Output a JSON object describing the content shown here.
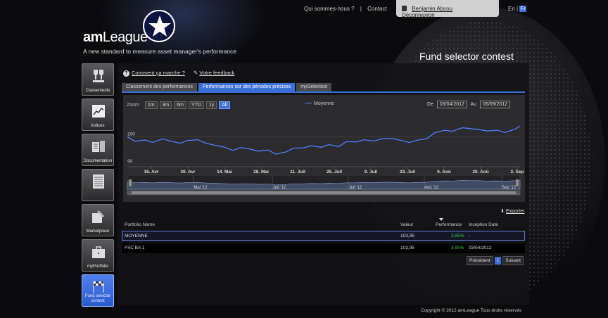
{
  "topnav": {
    "about": "Qui sommes-nous ?",
    "separator": "|",
    "contact": "Contact",
    "user_name": "Benjamin Abcou",
    "logout": "Déconnexion",
    "lang_en": "En",
    "lang_sep": "|",
    "lang_fr": "Fr"
  },
  "brand": {
    "logo_bold": "am",
    "logo_light": "League",
    "tagline": "A new standard to measure asset manager's performance",
    "section_title": "Fund selector contest"
  },
  "sidebar": {
    "items": [
      {
        "label": "Classements",
        "icon": "trophy-icon"
      },
      {
        "label": "Indices",
        "icon": "chart-icon"
      },
      {
        "label": "Documentation",
        "icon": "documents-icon"
      },
      {
        "label": "",
        "icon": "newspaper-icon"
      },
      {
        "label": "Marketplace",
        "icon": "marketplace-icon"
      },
      {
        "label": "myPortfolio",
        "icon": "briefcase-icon"
      },
      {
        "label": "Fund selector contest",
        "icon": "flags-icon"
      }
    ]
  },
  "help": {
    "how": "Comment ça marche ?",
    "feedback": "Votre feedback"
  },
  "tabs": [
    {
      "label": "Classement des performances"
    },
    {
      "label": "Performances sur des périodes précises"
    },
    {
      "label": "mySelection"
    }
  ],
  "chart_controls": {
    "zoom_label": "Zoom",
    "zoom_options": [
      "1m",
      "3m",
      "6m",
      "YTD",
      "1y",
      "All"
    ],
    "zoom_selected": "All",
    "legend": "Moyenne",
    "from_label": "De",
    "from_date": "03/04/2012",
    "to_label": "Au",
    "to_date": "06/09/2012"
  },
  "chart_data": {
    "type": "line",
    "series": [
      {
        "name": "Moyenne",
        "color": "#4f7fff",
        "x": [
          "2012-04-03",
          "2012-04-06",
          "2012-04-10",
          "2012-04-13",
          "2012-04-17",
          "2012-04-20",
          "2012-04-24",
          "2012-04-27",
          "2012-05-01",
          "2012-05-04",
          "2012-05-08",
          "2012-05-11",
          "2012-05-15",
          "2012-05-18",
          "2012-05-22",
          "2012-05-25",
          "2012-05-29",
          "2012-06-01",
          "2012-06-05",
          "2012-06-08",
          "2012-06-12",
          "2012-06-15",
          "2012-06-19",
          "2012-06-22",
          "2012-06-26",
          "2012-06-29",
          "2012-07-03",
          "2012-07-06",
          "2012-07-10",
          "2012-07-13",
          "2012-07-17",
          "2012-07-20",
          "2012-07-24",
          "2012-07-27",
          "2012-07-31",
          "2012-08-03",
          "2012-08-07",
          "2012-08-10",
          "2012-08-14",
          "2012-08-17",
          "2012-08-21",
          "2012-08-24",
          "2012-08-28",
          "2012-08-31",
          "2012-09-04",
          "2012-09-06"
        ],
        "values": [
          100.0,
          98.3,
          98.8,
          97.9,
          99.2,
          98.4,
          97.6,
          98.6,
          98.9,
          97.7,
          96.8,
          96.3,
          95.0,
          96.0,
          95.4,
          94.7,
          95.1,
          93.6,
          94.4,
          95.8,
          95.9,
          96.7,
          96.1,
          97.1,
          96.4,
          98.2,
          98.1,
          98.9,
          98.4,
          99.2,
          99.4,
          98.8,
          97.9,
          98.7,
          99.3,
          101.4,
          102.4,
          102.0,
          103.3,
          103.0,
          102.6,
          102.1,
          102.4,
          101.5,
          102.8,
          103.95
        ]
      }
    ],
    "xlabel": "",
    "ylabel": "",
    "ylim": [
      90,
      105
    ],
    "yticks": [
      "100",
      "90"
    ],
    "xtick_labels": [
      "16. Avr",
      "30. Avr",
      "14. Mai",
      "28. Mai",
      "11. Juil",
      "25. Juil",
      "9. Juil",
      "23. Juil",
      "6. Aoû",
      "20. Aoû",
      "3. Sep"
    ],
    "navigator_labels": [
      "Mai '12",
      "Juil '12",
      "Juil '12",
      "Aoû '12",
      "Sep '12"
    ]
  },
  "export": "Exporter",
  "table": {
    "headers": [
      "Portfolio Name",
      "Valeur",
      "Performance",
      "Inception Date"
    ],
    "rows": [
      [
        "MOYENNE",
        "103,95",
        "3,95%",
        "-"
      ],
      [
        "FSC BA 1",
        "103,95",
        "3,95%",
        "03/04/2012"
      ]
    ]
  },
  "pager": {
    "prev": "Précédent",
    "page": "1",
    "next": "Suivant"
  },
  "footer": "Copyright © 2012 amLeague Tous droits réservés",
  "colors": {
    "accent": "#3b6fd8",
    "positive": "#2fcf3a",
    "line": "#4f7fff"
  }
}
